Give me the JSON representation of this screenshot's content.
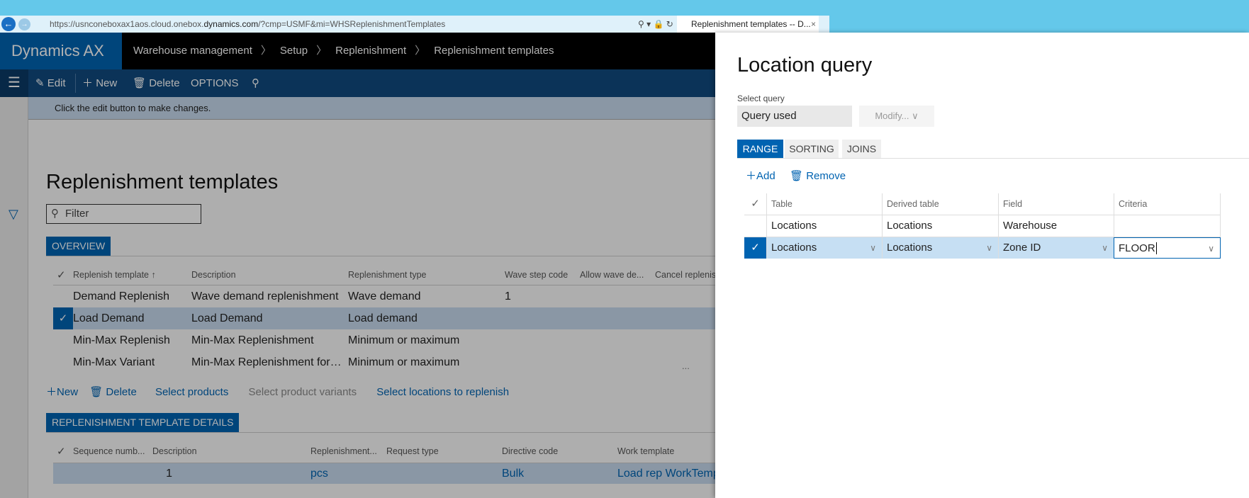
{
  "browser": {
    "url_prefix": "https://usnconeboxax1aos.cloud.onebox.",
    "url_domain": "dynamics.com",
    "url_suffix": "/?cmp=USMF&mi=WHSReplenishmentTemplates",
    "tab_title": "Replenishment templates -- D...",
    "tab_close": "×",
    "addr_icons": "⚲ ▾ 🔒 ↻"
  },
  "header": {
    "brand": "Dynamics AX",
    "breadcrumb": [
      "Warehouse management",
      "Setup",
      "Replenishment",
      "Replenishment templates"
    ],
    "sep": "〉"
  },
  "toolbar": {
    "edit": "Edit",
    "new": "New",
    "delete": "Delete",
    "options": "OPTIONS"
  },
  "message": "Click the edit button to make changes.",
  "page": {
    "title": "Replenishment templates",
    "filter_placeholder": "Filter"
  },
  "overview": {
    "tab": "OVERVIEW",
    "columns": [
      "Replenish template ↑",
      "Description",
      "Replenishment type",
      "Wave step code",
      "Allow wave de...",
      "Cancel replenis..."
    ],
    "rows": [
      {
        "template": "Demand Replenish",
        "description": "Wave demand replenishment",
        "type": "Wave demand",
        "wave": "1",
        "selected": false
      },
      {
        "template": "Load Demand",
        "description": "Load Demand",
        "type": "Load demand",
        "wave": "",
        "selected": true
      },
      {
        "template": "Min-Max Replenish",
        "description": "Min-Max Replenishment",
        "type": "Minimum or maximum",
        "wave": "",
        "selected": false
      },
      {
        "template": "Min-Max Variant",
        "description": "Min-Max Replenishment for vari...",
        "type": "Minimum or maximum",
        "wave": "",
        "selected": false
      }
    ],
    "more": "...",
    "actions": {
      "new": "New",
      "delete": "Delete",
      "select_products": "Select products",
      "select_variants": "Select product variants",
      "select_locations": "Select locations to replenish"
    }
  },
  "details": {
    "tab": "REPLENISHMENT TEMPLATE DETAILS",
    "columns": [
      "Sequence numb...",
      "Description",
      "Replenishment...",
      "Request type",
      "Directive code",
      "Work template"
    ],
    "rows": [
      {
        "sequence": "1",
        "description": "",
        "unit": "pcs",
        "request_type": "",
        "directive": "Bulk",
        "work_template": "Load rep WorkTempl"
      }
    ]
  },
  "panel": {
    "title": "Location query",
    "select_query_label": "Select query",
    "query_value": "Query used",
    "modify": "Modify... ∨",
    "tabs": [
      "RANGE",
      "SORTING",
      "JOINS"
    ],
    "active_tab": "RANGE",
    "add": "Add",
    "remove": "Remove",
    "columns": [
      "Table",
      "Derived table",
      "Field",
      "Criteria"
    ],
    "rows": [
      {
        "table": "Locations",
        "derived": "Locations",
        "field": "Warehouse",
        "criteria": "",
        "selected": false
      },
      {
        "table": "Locations",
        "derived": "Locations",
        "field": "Zone ID",
        "criteria": "FLOOR",
        "selected": true
      }
    ]
  },
  "colors": {
    "accent": "#0063b1",
    "toolbar": "#114a7e",
    "header": "#000000",
    "selected_row": "#c6d9ec"
  }
}
